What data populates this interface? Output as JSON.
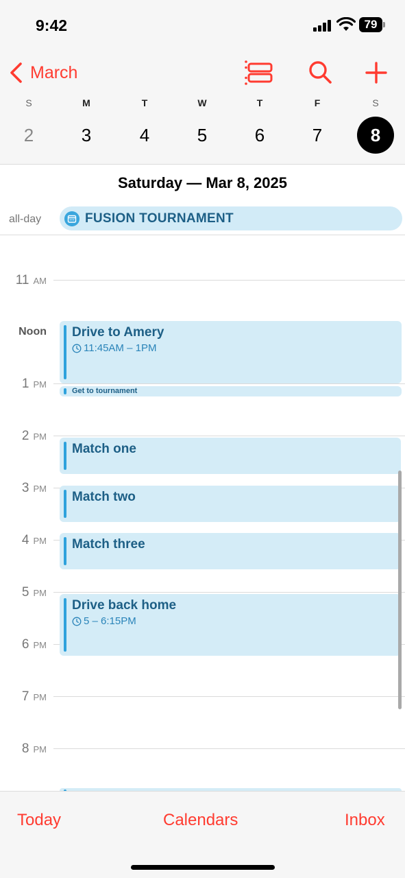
{
  "status_bar": {
    "time": "9:42",
    "battery": "79"
  },
  "header": {
    "back_label": "March",
    "weekdays": [
      "S",
      "M",
      "T",
      "W",
      "T",
      "F",
      "S"
    ],
    "dates": [
      "2",
      "3",
      "4",
      "5",
      "6",
      "7",
      "8"
    ],
    "selected_date": "8"
  },
  "day_title": "Saturday — Mar 8, 2025",
  "all_day": {
    "label": "all-day",
    "event": "FUSION TOURNAMENT"
  },
  "hours": [
    {
      "num": "11",
      "ap": "AM"
    },
    {
      "num": "Noon",
      "ap": ""
    },
    {
      "num": "1",
      "ap": "PM"
    },
    {
      "num": "2",
      "ap": "PM"
    },
    {
      "num": "3",
      "ap": "PM"
    },
    {
      "num": "4",
      "ap": "PM"
    },
    {
      "num": "5",
      "ap": "PM"
    },
    {
      "num": "6",
      "ap": "PM"
    },
    {
      "num": "7",
      "ap": "PM"
    },
    {
      "num": "8",
      "ap": "PM"
    }
  ],
  "events": [
    {
      "title": "Drive to Amery",
      "time": "11:45AM – 1PM"
    },
    {
      "title": "Get to tournament"
    },
    {
      "title": "Match one"
    },
    {
      "title": "Match two"
    },
    {
      "title": "Match three"
    },
    {
      "title": "Drive back home",
      "time": "5 – 6:15PM"
    }
  ],
  "tabs": {
    "today": "Today",
    "calendars": "Calendars",
    "inbox": "Inbox"
  },
  "colors": {
    "accent": "#ff3b30",
    "event_bg": "#d4ecf7",
    "event_text": "#1d5f86",
    "event_bar": "#2ea2dc"
  }
}
